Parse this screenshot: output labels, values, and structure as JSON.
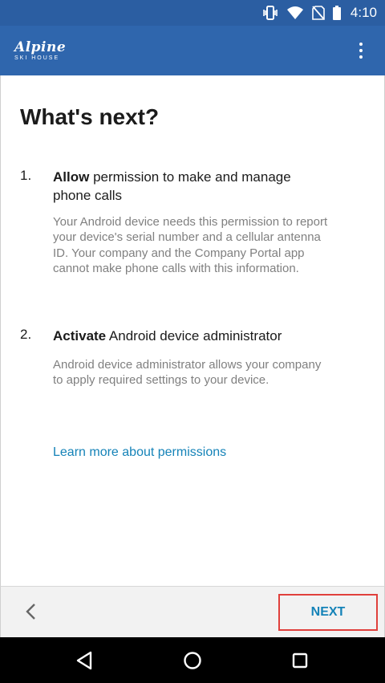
{
  "status_bar": {
    "time": "4:10",
    "icons": [
      "vibrate-icon",
      "wifi-icon",
      "no-sim-icon",
      "battery-icon"
    ]
  },
  "app_bar": {
    "brand_name": "Alpine",
    "brand_sub": "SKI HOUSE",
    "menu_icon": "overflow-menu-icon"
  },
  "page": {
    "title": "What's next?",
    "steps": [
      {
        "number": "1.",
        "bold": "Allow",
        "rest": " permission to make and manage phone calls",
        "description": "Your Android device needs this permission to report your device's serial number and a cellular antenna ID. Your company and the Company Portal app cannot make phone calls with this information."
      },
      {
        "number": "2.",
        "bold": "Activate",
        "rest": " Android device administrator",
        "description": "Android device administrator allows your company to apply required settings to your device."
      }
    ],
    "learn_more": "Learn more about permissions"
  },
  "bottom_bar": {
    "back_icon": "chevron-left-icon",
    "next_label": "NEXT",
    "highlight_color": "#e0403c"
  },
  "nav_bar": {
    "icons": [
      "back-triangle-icon",
      "home-circle-icon",
      "recents-square-icon"
    ]
  },
  "colors": {
    "status_bar": "#2b5ea2",
    "app_bar": "#2f66ad",
    "link": "#1583b8",
    "description_text": "#808080"
  }
}
